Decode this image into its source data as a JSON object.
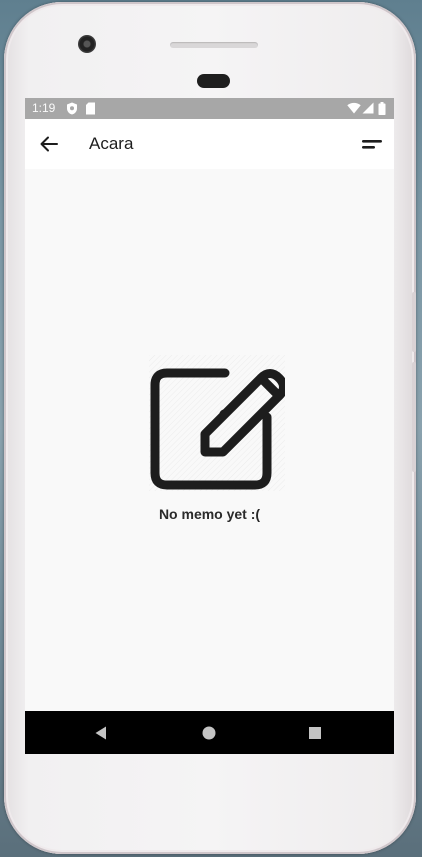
{
  "status_bar": {
    "time": "1:19",
    "left_icons": [
      "shield-icon",
      "sd-card-icon"
    ],
    "right_icons": [
      "wifi-icon",
      "signal-icon",
      "battery-icon"
    ]
  },
  "app_bar": {
    "title": "Acara",
    "back_icon": "arrow-left-icon",
    "menu_icon": "sort-menu-icon"
  },
  "empty_state": {
    "icon": "edit-note-icon",
    "message": "No memo yet :("
  },
  "nav_bar": {
    "buttons": [
      "back-triangle-icon",
      "home-circle-icon",
      "recents-square-icon"
    ]
  },
  "colors": {
    "status_bar_bg": "#a7a7a7",
    "app_bar_bg": "#ffffff",
    "content_bg": "#f9f9f9",
    "nav_bar_bg": "#000000",
    "icon_dark": "#1d1d1d"
  }
}
